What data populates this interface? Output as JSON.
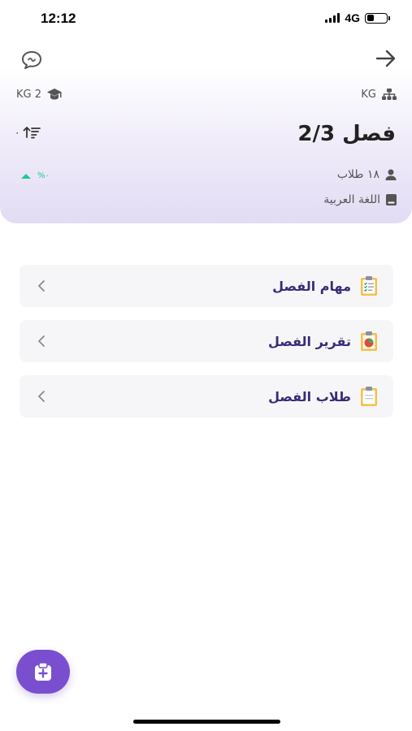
{
  "status_bar": {
    "time": "12:12",
    "network": "4G",
    "battery_level": 0.35
  },
  "header": {
    "level_left": "KG 2",
    "level_right": "KG",
    "class_title": "فصل 2/3",
    "sort_value": "٠",
    "percent_symbol": "%٠",
    "students_count": "١٨ طلاب",
    "subject": "اللغة العربية"
  },
  "menu": [
    {
      "label": "مهام الفصل"
    },
    {
      "label": "تقرير الفصل"
    },
    {
      "label": "طلاب الفصل"
    }
  ],
  "colors": {
    "accent": "#7a4fcf",
    "menu_text": "#3b2b78",
    "positive": "#24c59a"
  },
  "icons": [
    "chat-icon",
    "arrow-right-icon",
    "graduation-cap-icon",
    "hierarchy-icon",
    "sort-icon",
    "user-icon",
    "book-icon",
    "clipboard-checklist-icon",
    "report-icon",
    "clipboard-icon",
    "chevron-left-icon",
    "add-clipboard-icon"
  ]
}
